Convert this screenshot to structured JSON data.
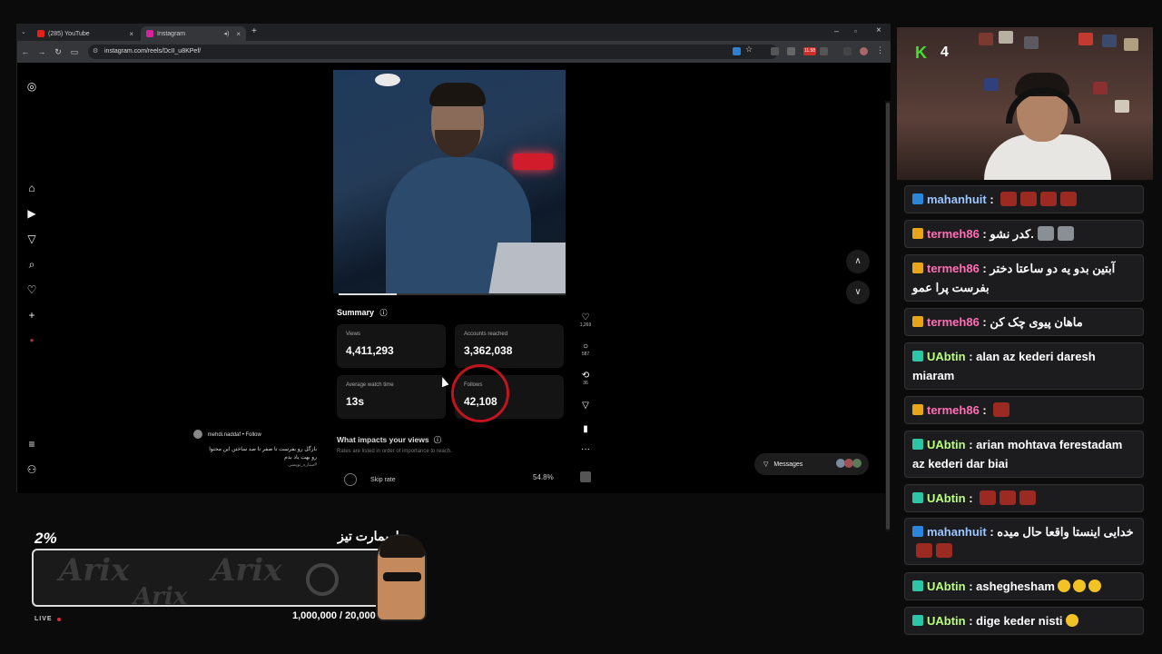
{
  "browser": {
    "tabs": [
      {
        "label": "(285) YouTube",
        "active": false,
        "icon": "youtube-icon"
      },
      {
        "label": "Instagram",
        "active": true,
        "icon": "instagram-icon"
      }
    ],
    "url": "instagram.com/reels/DcII_u8KPef/",
    "ext_badge": "11.58"
  },
  "reel": {
    "summary_title": "Summary",
    "stats": [
      {
        "label": "Views",
        "value": "4,411,293"
      },
      {
        "label": "Accounts reached",
        "value": "3,362,038"
      },
      {
        "label": "Average watch time",
        "value": "13s"
      },
      {
        "label": "Follows",
        "value": "42,108"
      }
    ],
    "impacts_title": "What impacts your views",
    "impacts_sub": "Rates are listed in order of importance to reach.",
    "skip_label": "Skip rate",
    "skip_value": "54.8%",
    "actions": {
      "likes": "1,269",
      "comments": "587",
      "reposts": "36"
    },
    "author": "mehdi.naddaf • Follow",
    "caption_line1": "بازگل رو بفرست تا صفر تا صد ساختن این محتوا",
    "caption_line2": "رو بهت یاد بدم",
    "caption_line3": "#ستاره_نویسی",
    "messages_label": "Messages"
  },
  "stream": {
    "kick_count": "4",
    "goal_percent": "2%",
    "goal_title": "اسمارت تیز",
    "goal_count": "1,000,000 / 20,000",
    "live_label": "LIVE",
    "watermark": "Arix"
  },
  "chat": [
    {
      "user": "mahanhuit",
      "text": "",
      "badge": "blue",
      "color": "b",
      "emotes": 4
    },
    {
      "user": "termeh86",
      "text": "کدر نشو.",
      "badge": "gold",
      "color": "p",
      "emotes": 2,
      "cat": true
    },
    {
      "user": "termeh86",
      "text": "آبتین بدو یه دو ساعتا دختر بفرست پرا عمو",
      "badge": "gold",
      "color": "p",
      "emotes": 0
    },
    {
      "user": "termeh86",
      "text": "ماهان پیوی چک کن",
      "badge": "gold",
      "color": "p",
      "emotes": 0
    },
    {
      "user": "UAbtin",
      "text": "alan az kederi daresh miaram",
      "badge": "green",
      "color": "g",
      "emotes": 0
    },
    {
      "user": "termeh86",
      "text": "",
      "badge": "gold",
      "color": "p",
      "emotes": 1
    },
    {
      "user": "UAbtin",
      "text": "arian mohtava ferestadam az kederi dar biai",
      "badge": "green",
      "color": "g",
      "emotes": 0
    },
    {
      "user": "UAbtin",
      "text": "",
      "badge": "green",
      "color": "g",
      "emotes": 3
    },
    {
      "user": "mahanhuit",
      "text": "خدایی اینستا واقعا حال میده",
      "badge": "blue",
      "color": "b",
      "emotes": 2
    },
    {
      "user": "UAbtin",
      "text": "asheghesham",
      "badge": "green",
      "color": "g",
      "smileys": 3
    },
    {
      "user": "UAbtin",
      "text": "dige keder nisti",
      "badge": "green",
      "color": "g",
      "smileys": 1
    }
  ],
  "colors": {
    "accent_red": "#c01520",
    "kick_green": "#43e02a"
  }
}
